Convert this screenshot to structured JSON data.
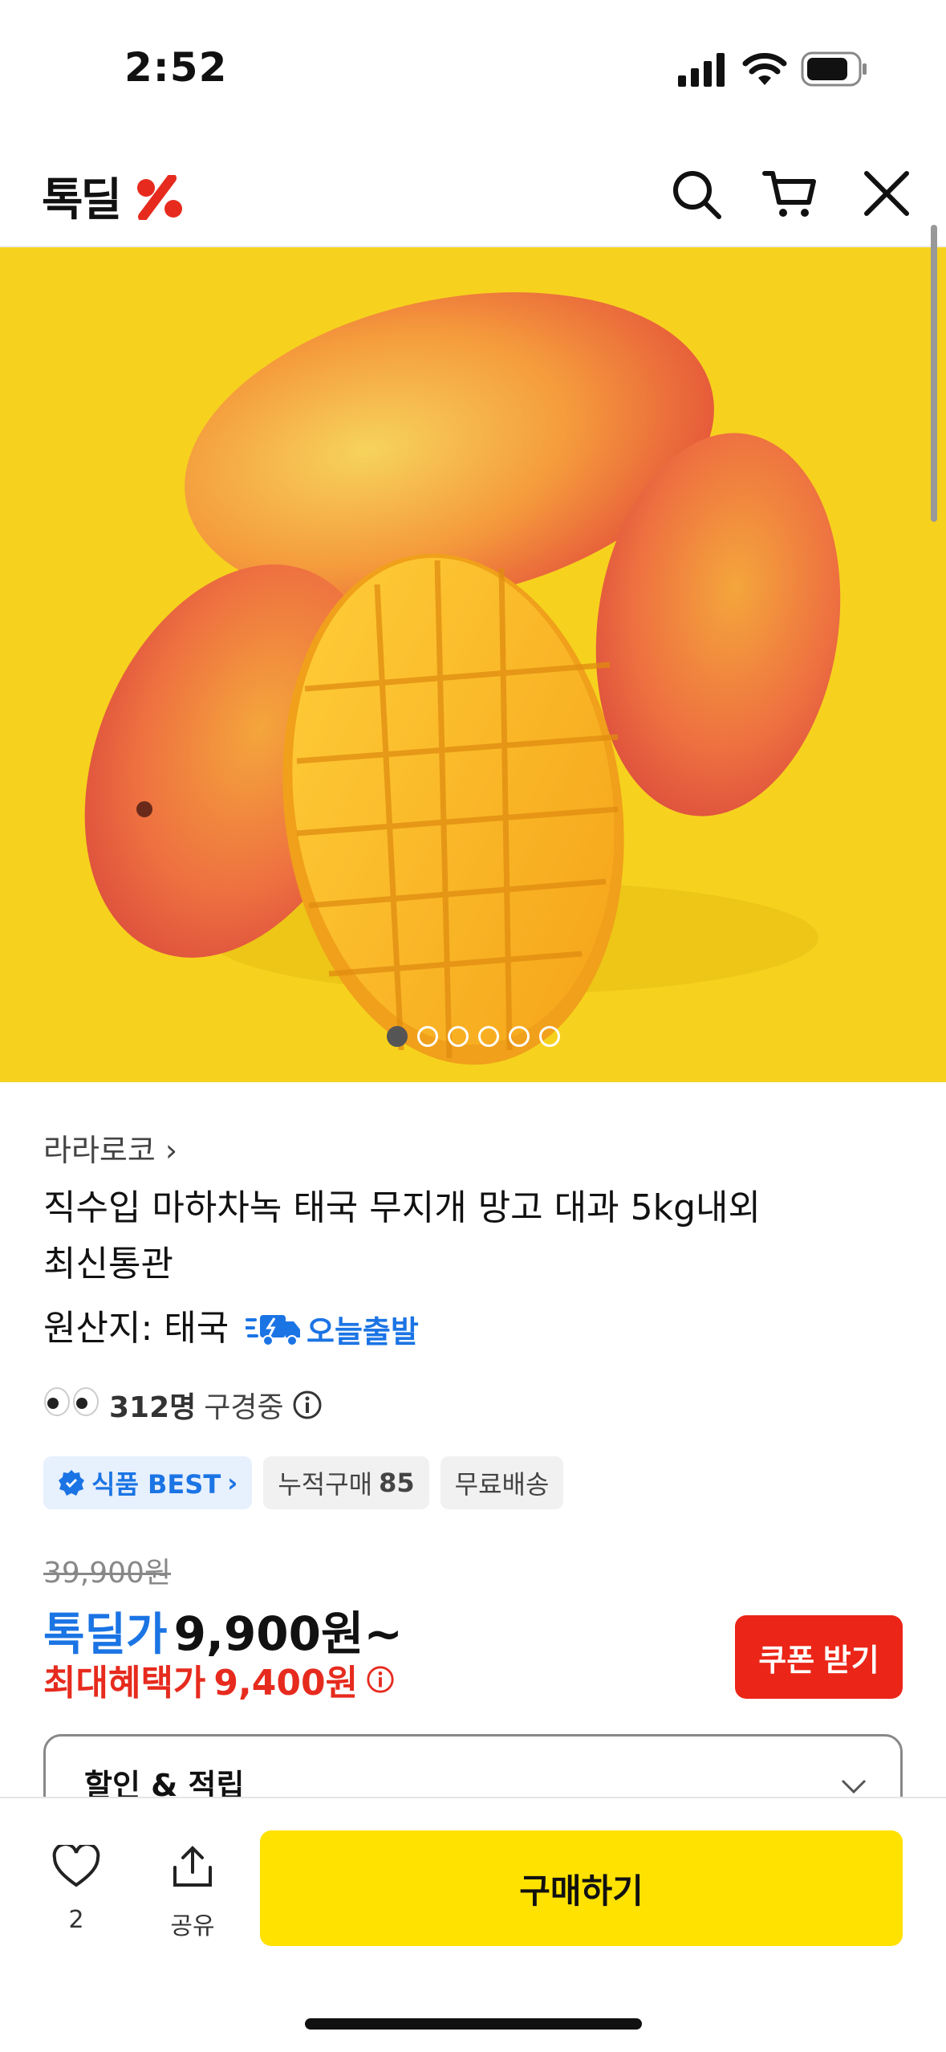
{
  "status_bar": {
    "time": "2:52"
  },
  "header": {
    "logo_text": "톡딜",
    "logo_accent_color": "#e62b1e"
  },
  "hero": {
    "background_color": "#f6d21e",
    "dots_total": 6,
    "active_dot": 1
  },
  "product": {
    "seller": "라라로코 ›",
    "title_line1": "직수입 마하차녹 태국 무지개 망고 대과 5kg내외",
    "title_line2": "최신통관",
    "origin": "원산지: 태국",
    "ship_badge": "오늘출발",
    "viewers_count": "312명",
    "viewers_text": "구경중",
    "tags": {
      "best_label": "식품 BEST",
      "purchases_label": "누적구매",
      "purchases_count": "85",
      "free_shipping": "무료배송"
    },
    "original_price": "39,900원",
    "deal_label": "톡딜가",
    "deal_price": "9,900원~",
    "max_benefit_label": "최대혜택가",
    "max_benefit_price": "9,400원",
    "coupon_button": "쿠폰 받기",
    "discount_section": "할인 & 적립"
  },
  "bottom_bar": {
    "likes_count": "2",
    "share_label": "공유",
    "buy_button": "구매하기"
  },
  "colors": {
    "accent_blue": "#1b74e4",
    "accent_red": "#e62b1e",
    "buy_yellow": "#ffe200"
  }
}
